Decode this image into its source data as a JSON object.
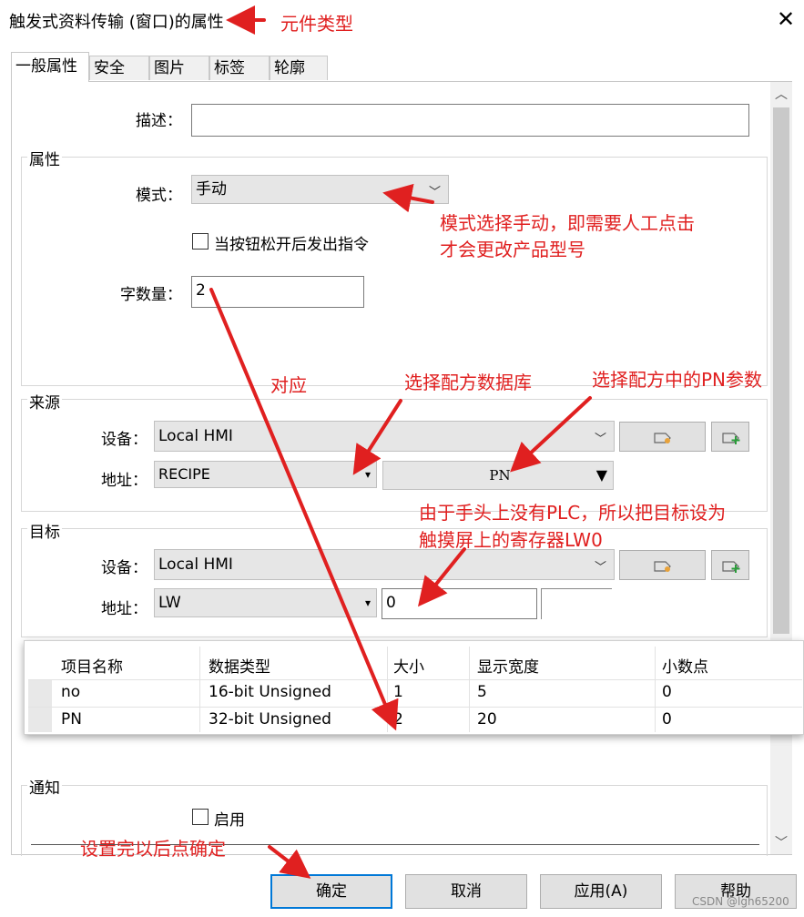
{
  "window": {
    "title": "触发式资料传输 (窗口)的属性",
    "close_glyph": "✕"
  },
  "tabs": [
    {
      "label": "一般属性",
      "active": true
    },
    {
      "label": "安全",
      "active": false
    },
    {
      "label": "图片",
      "active": false
    },
    {
      "label": "标签",
      "active": false
    },
    {
      "label": "轮廓",
      "active": false
    }
  ],
  "description": {
    "label": "描述：",
    "value": ""
  },
  "properties": {
    "group_title": "属性",
    "mode_label": "模式：",
    "mode_value": "手动",
    "release_checkbox_label": "当按钮松开后发出指令",
    "release_checked": false,
    "word_count_label": "字数量：",
    "word_count_value": "2"
  },
  "source": {
    "group_title": "来源",
    "device_label": "设备：",
    "device_value": "Local HMI",
    "address_label": "地址：",
    "address_value": "RECIPE",
    "param_value": "PN"
  },
  "target": {
    "group_title": "目标",
    "device_label": "设备：",
    "device_value": "Local HMI",
    "address_label": "地址：",
    "address_value": "LW",
    "address_number": "0"
  },
  "table": {
    "headers": [
      "项目名称",
      "数据类型",
      "大小",
      "显示宽度",
      "小数点"
    ],
    "rows": [
      [
        "no",
        "16-bit Unsigned",
        "1",
        "5",
        "0"
      ],
      [
        "PN",
        "32-bit Unsigned",
        "2",
        "20",
        "0"
      ]
    ]
  },
  "notify": {
    "group_title": "通知",
    "enable_label": "启用",
    "enable_checked": false
  },
  "footer": {
    "ok": "确定",
    "cancel": "取消",
    "apply": "应用(A)",
    "help": "帮助"
  },
  "annotations": {
    "component_type": "元件类型",
    "mode_note_1": "模式选择手动，即需要人工点击",
    "mode_note_2": "才会更改产品型号",
    "correspond": "对应",
    "select_db": "选择配方数据库",
    "select_pn": "选择配方中的PN参数",
    "plc_note_1": "由于手头上没有PLC，所以把目标设为",
    "plc_note_2": "触摸屏上的寄存器LW0",
    "confirm_note": "设置完以后点确定"
  },
  "watermark": "CSDN @lgh65200",
  "colors": {
    "annotation": "#e02020",
    "primary_border": "#0078d7"
  }
}
